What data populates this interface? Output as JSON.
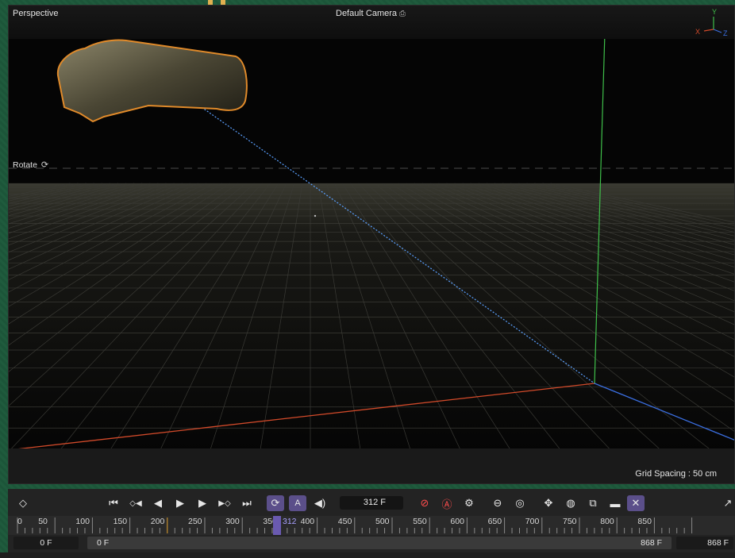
{
  "viewport": {
    "title": "Perspective",
    "camera": "Default Camera",
    "camera_icon": "camera-icon",
    "rotate_label": "Rotate",
    "grid_spacing": "Grid Spacing : 50 cm",
    "axes": {
      "y": "Y",
      "x": "X",
      "z": "Z"
    }
  },
  "toolbar": {
    "buttons": [
      {
        "name": "keyframe-diamond-button",
        "glyph": "◇"
      },
      {
        "name": "go-to-start-button",
        "glyph": "⏮"
      },
      {
        "name": "prev-key-button",
        "glyph": "◇◀"
      },
      {
        "name": "prev-frame-button",
        "glyph": "◀"
      },
      {
        "name": "play-button",
        "glyph": "▶"
      },
      {
        "name": "next-frame-button",
        "glyph": "▶"
      },
      {
        "name": "next-key-button",
        "glyph": "▶◇"
      },
      {
        "name": "go-to-end-button",
        "glyph": "⏭"
      },
      {
        "name": "loop-button",
        "glyph": "⟳"
      },
      {
        "name": "auto-key-mode-button",
        "glyph": "A"
      },
      {
        "name": "sound-button",
        "glyph": "🔊"
      }
    ],
    "current_frame": "312 F"
  },
  "ruler": {
    "ticks": [
      "0",
      "50",
      "100",
      "150",
      "200",
      "250",
      "300",
      "350",
      "400",
      "450",
      "500",
      "550",
      "600",
      "650",
      "700",
      "750",
      "800",
      "850"
    ],
    "current": "312"
  },
  "range": {
    "start_outer": "0 F",
    "start_inner": "0 F",
    "end_inner": "868 F",
    "end_outer": "868 F"
  },
  "colors": {
    "accent": "#5b4f8a",
    "record": "#ff4d4d",
    "object_outline": "#e08a2a",
    "x_axis": "#d24a2a",
    "y_axis": "#3fc04a",
    "z_axis": "#3a6ee0"
  }
}
